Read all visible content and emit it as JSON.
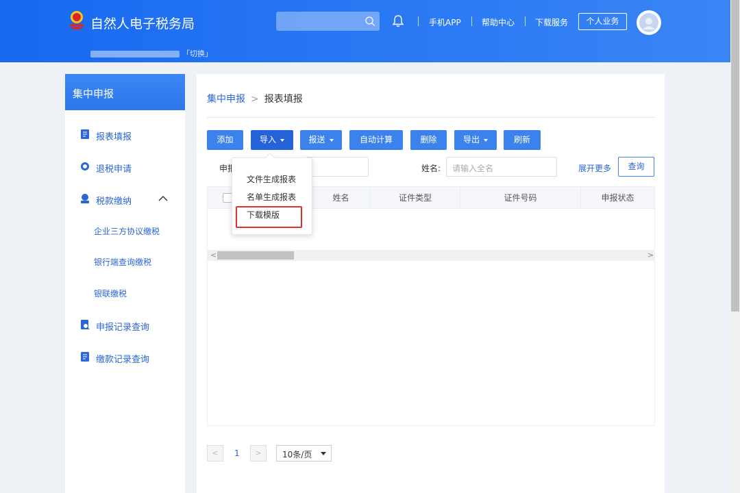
{
  "header": {
    "title": "自然人电子税务局",
    "sub_switch": "「切换」",
    "links": [
      "手机APP",
      "帮助中心",
      "下载服务"
    ],
    "personal_btn": "个人业务"
  },
  "sidebar": {
    "title": "集中申报",
    "items": [
      {
        "label": "报表填报",
        "icon": "form-icon"
      },
      {
        "label": "退税申请",
        "icon": "refund-icon"
      },
      {
        "label": "税款缴纳",
        "icon": "tax-payment-icon"
      },
      {
        "label": "申报记录查询",
        "icon": "record-search-icon"
      },
      {
        "label": "缴款记录查询",
        "icon": "payment-record-icon"
      }
    ],
    "sub_items": [
      "企业三方协议缴税",
      "银行端查询缴税",
      "银联缴税"
    ]
  },
  "main": {
    "breadcrumb": {
      "parent": "集中申报",
      "current": "报表填报"
    },
    "toolbar": {
      "add": "添加",
      "import": "导入",
      "send": "报送",
      "auto_calc": "自动计算",
      "delete": "删除",
      "export": "导出",
      "refresh": "刷新"
    },
    "filter": {
      "label1": "申报",
      "name_label": "姓名:",
      "name_placeholder": "请输入全名",
      "expand": "展开更多",
      "query": "查询"
    },
    "table": {
      "columns": [
        "姓名",
        "证件类型",
        "证件号码",
        "申报状态"
      ]
    },
    "pagination": {
      "current_page": "1",
      "page_size": "10条/页",
      "prev": "<",
      "next": ">"
    }
  },
  "dropdown": {
    "items": [
      "文件生成报表",
      "名单生成报表",
      "下载模版"
    ],
    "highlighted": "下载模版"
  },
  "colors": {
    "primary": "#3b82ec",
    "header": "#1769f1",
    "highlight": "#e0312f"
  }
}
